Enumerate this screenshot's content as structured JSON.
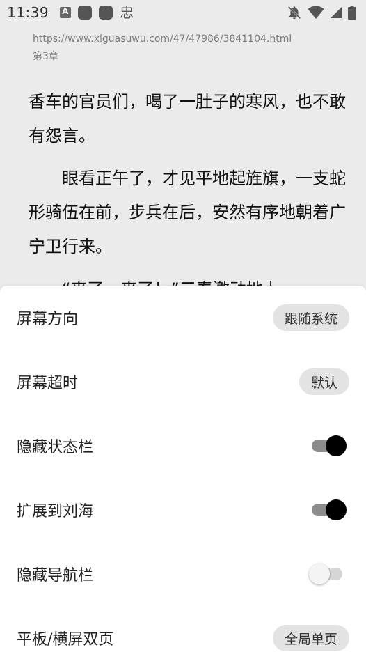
{
  "status_bar": {
    "time": "11:39",
    "left_glyph": "忠",
    "icons": [
      "app-a-icon",
      "square-app-icon",
      "square-app-icon",
      "bell-off-icon",
      "wifi-icon",
      "signal-icon",
      "battery-icon"
    ]
  },
  "reader": {
    "url": "https://www.xiguasuwu.com/47/47986/3841104.html",
    "chapter": "第3章",
    "paragraphs": [
      "香车的官员们，喝了一肚子的寒风，也不敢有怨言。",
      "眼看正午了，才见平地起旌旗，一支蛇形骑伍在前，步兵在后，安然有序地朝着广宁卫行来。",
      "“来了，来了！”三春激动地上"
    ]
  },
  "settings": {
    "rows": [
      {
        "label": "屏幕方向",
        "type": "chip",
        "value": "跟随系统"
      },
      {
        "label": "屏幕超时",
        "type": "chip",
        "value": "默认"
      },
      {
        "label": "隐藏状态栏",
        "type": "switch",
        "checked": true
      },
      {
        "label": "扩展到刘海",
        "type": "switch",
        "checked": true
      },
      {
        "label": "隐藏导航栏",
        "type": "switch",
        "checked": false
      },
      {
        "label": "平板/横屏双页",
        "type": "chip",
        "value": "全局单页"
      }
    ]
  },
  "colors": {
    "background": "#ebebeb",
    "sheet": "#ffffff",
    "chip": "#e3e3e3",
    "switch_on": "#000000"
  }
}
